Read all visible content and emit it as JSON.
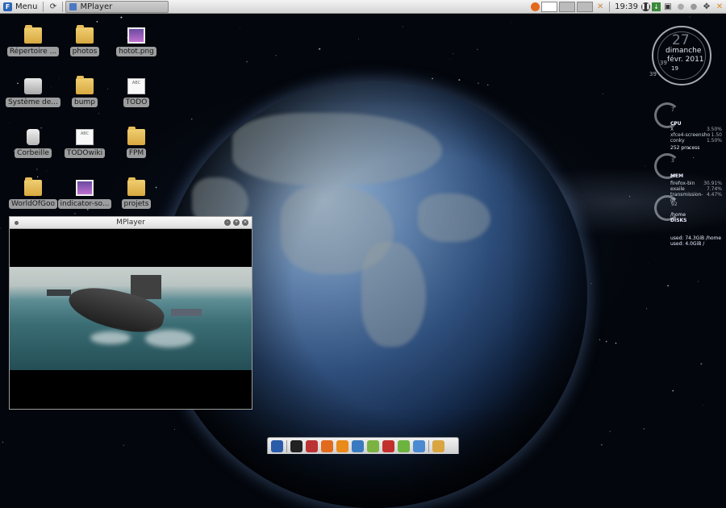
{
  "top_panel": {
    "menu_label": "Menu",
    "task_title": "MPlayer",
    "clock": "19:39"
  },
  "desktop_icons": [
    {
      "label": "Répertoire ...",
      "icon": "home-folder-icon"
    },
    {
      "label": "photos",
      "icon": "folder-icon"
    },
    {
      "label": "hotot.png",
      "icon": "image-file-icon"
    },
    {
      "label": "Système de...",
      "icon": "drive-icon"
    },
    {
      "label": "bump",
      "icon": "folder-icon"
    },
    {
      "label": "TODO",
      "icon": "text-file-icon"
    },
    {
      "label": "Corbeille",
      "icon": "trash-icon"
    },
    {
      "label": "TODOwiki",
      "icon": "text-file-icon"
    },
    {
      "label": "FPM",
      "icon": "folder-icon"
    },
    {
      "label": "WorldOfGoo",
      "icon": "folder-icon"
    },
    {
      "label": "indicator-so...",
      "icon": "image-file-icon"
    },
    {
      "label": "projets",
      "icon": "folder-icon"
    }
  ],
  "file_icon_text": "ABC",
  "mplayer_window": {
    "title": "MPlayer"
  },
  "conky": {
    "date": {
      "day": "27",
      "weekday": "dimanche",
      "month_year": "févr. 2011",
      "sec_a": "39",
      "sec_b": "19",
      "sec_c": "39"
    },
    "cpu": {
      "ring_value": "7",
      "heading": "CPU",
      "rows": [
        {
          "name": "X",
          "value": "3.50%"
        },
        {
          "name": "xfce4-screensho",
          "value": "1.50"
        },
        {
          "name": "conky",
          "value": "1.50%"
        }
      ],
      "process_count": "252 process"
    },
    "mem": {
      "ring_value": "3",
      "heading": "MEM",
      "rows": [
        {
          "name": "firefox-bin",
          "value": "30.91%"
        },
        {
          "name": "exaile",
          "value": "7.74%"
        },
        {
          "name": "transmission-gt",
          "value": "4.47%"
        }
      ]
    },
    "disks": {
      "ring_value": "92",
      "mount": "/home",
      "heading": "DISKS",
      "rows": [
        "used: 74.3GiB /home",
        "used: 4.0GiB /"
      ]
    }
  },
  "colors": {
    "accent_blue": "#2c66b8",
    "panel_top": "#f4f4f4",
    "panel_bottom": "#d4d4d4"
  },
  "dock_items": [
    "window-list-icon",
    "terminal-icon",
    "image-editor-icon",
    "firefox-icon",
    "rss-icon",
    "chat-icon",
    "android-icon",
    "ubuntu-software-icon",
    "media-player-icon",
    "search-icon",
    "folder-icon"
  ]
}
